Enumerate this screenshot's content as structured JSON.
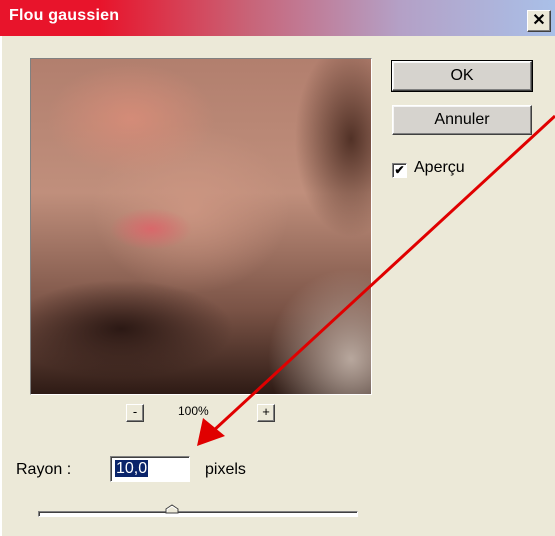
{
  "window": {
    "title": "Flou gaussien",
    "close_label": "✕"
  },
  "preview": {
    "zoom_out_label": "-",
    "zoom_in_label": "+",
    "zoom_level": "100%"
  },
  "buttons": {
    "ok_label": "OK",
    "cancel_label": "Annuler"
  },
  "options": {
    "preview_checked": true,
    "preview_check_glyph": "✔",
    "preview_label": "Aperçu"
  },
  "radius": {
    "label": "Rayon :",
    "value": "10,0",
    "unit": "pixels",
    "slider_fraction": 0.42
  },
  "colors": {
    "title_gradient_start": "#e8142b",
    "title_gradient_end": "#a9c0e8",
    "dialog_background": "#ece9d8",
    "selection_highlight": "#0a246a",
    "annotation_arrow": "#e00000"
  },
  "annotation": {
    "arrow_icon": "red-arrow-annotation"
  }
}
